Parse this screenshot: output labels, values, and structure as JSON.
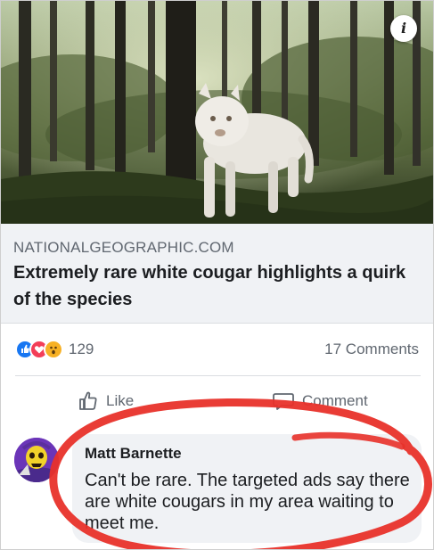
{
  "photo": {
    "description_icon": "info-icon",
    "info_label": "i"
  },
  "link_preview": {
    "domain": "NATIONALGEOGRAPHIC.COM",
    "title": "Extremely rare white cougar highlights a quirk of the species"
  },
  "stats": {
    "reaction_icons": [
      "like-reaction-icon",
      "love-reaction-icon",
      "wow-reaction-icon"
    ],
    "reaction_count": "129",
    "comments_count": "17 Comments"
  },
  "actions": {
    "like_label": "Like",
    "comment_label": "Comment"
  },
  "comment": {
    "author": "Matt Barnette",
    "text": "Can't be rare. The targeted ads say there are white cougars in my area waiting to meet me."
  },
  "colors": {
    "brand_blue": "#1877f2",
    "annotation_red": "#e8312a",
    "muted_text": "#606770",
    "bubble_bg": "#f0f2f5"
  }
}
